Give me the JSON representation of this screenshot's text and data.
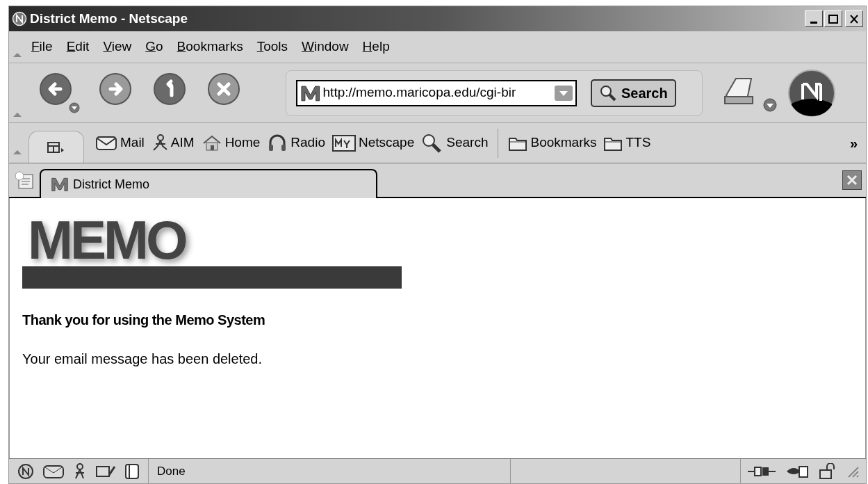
{
  "window": {
    "title": "District Memo - Netscape"
  },
  "menu": [
    {
      "label": "File"
    },
    {
      "label": "Edit"
    },
    {
      "label": "View"
    },
    {
      "label": "Go"
    },
    {
      "label": "Bookmarks"
    },
    {
      "label": "Tools"
    },
    {
      "label": "Window"
    },
    {
      "label": "Help"
    }
  ],
  "nav_buttons": [
    {
      "kind": "back",
      "disabled": false
    },
    {
      "kind": "forward",
      "disabled": true
    },
    {
      "kind": "reload",
      "disabled": false
    },
    {
      "kind": "stop",
      "disabled": true
    }
  ],
  "address": {
    "value": "http://memo.maricopa.edu/cgi-bir"
  },
  "search_button": "Search",
  "personal_toolbar": [
    {
      "kind": "mail",
      "label": "Mail"
    },
    {
      "kind": "aim",
      "label": "AIM"
    },
    {
      "kind": "home",
      "label": "Home"
    },
    {
      "kind": "radio",
      "label": "Radio"
    },
    {
      "kind": "my",
      "label": "Netscape"
    },
    {
      "kind": "search",
      "label": "Search"
    },
    {
      "kind": "folder",
      "label": "Bookmarks"
    },
    {
      "kind": "folder",
      "label": "TTS"
    }
  ],
  "overflow": "»",
  "tabs": [
    {
      "label": "District Memo",
      "selected": true
    }
  ],
  "page": {
    "logo": "MEMO",
    "heading": "Thank you for using the Memo System",
    "message": "Your email message has been deleted."
  },
  "status_bar": {
    "text": "Done"
  }
}
